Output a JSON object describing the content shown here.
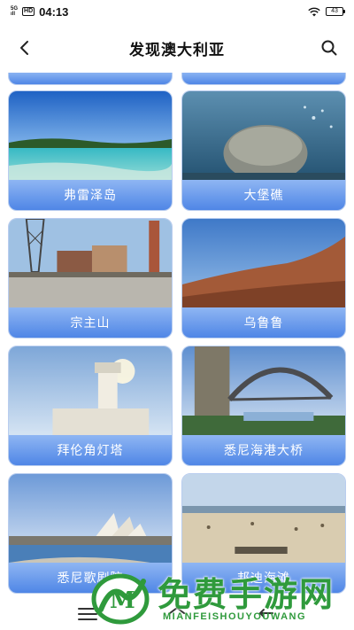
{
  "status_bar": {
    "network_top": "5G",
    "network_bottom": "ıll",
    "hd": "HD",
    "time": "04:13",
    "battery": "43"
  },
  "header": {
    "title": "发现澳大利亚",
    "back_icon": "chevron-left-icon",
    "search_icon": "search-icon"
  },
  "destinations": [
    {
      "name": "弗雷泽岛"
    },
    {
      "name": "大堡礁"
    },
    {
      "name": "宗主山"
    },
    {
      "name": "乌鲁鲁"
    },
    {
      "name": "拜伦角灯塔"
    },
    {
      "name": "悉尼海港大桥"
    },
    {
      "name": "悉尼歌剧院"
    },
    {
      "name": "邦迪海滩"
    }
  ],
  "watermark": {
    "title": "免费手游网",
    "subtitle": "MIANFEISHOUYOUWANG",
    "logo_letter": "M"
  },
  "colors": {
    "label_band_top": "#8fb6f3",
    "label_band_bottom": "#4f86e6",
    "watermark_green": "#2f9a3c"
  }
}
